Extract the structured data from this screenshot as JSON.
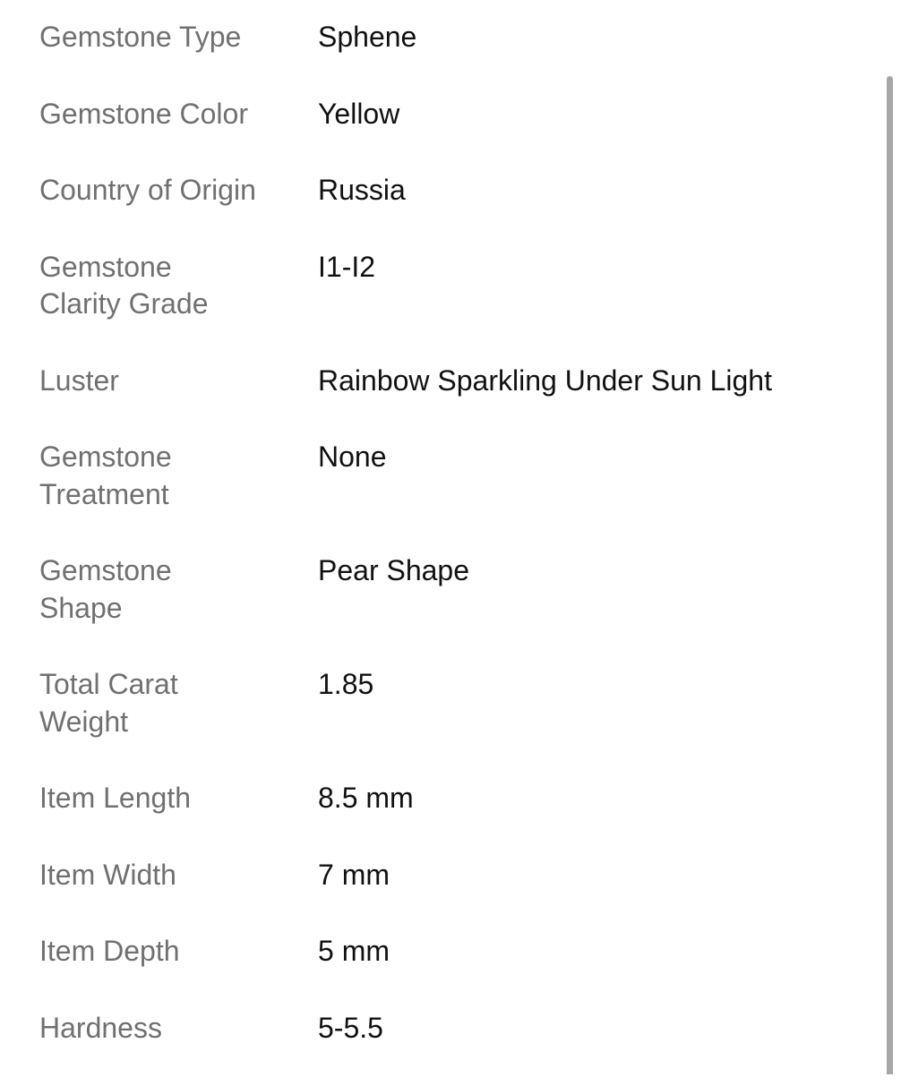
{
  "specifics": [
    {
      "label": "Gemstone Type",
      "value": "Sphene"
    },
    {
      "label": "Gemstone Color",
      "value": "Yellow"
    },
    {
      "label": "Country of Origin",
      "value": "Russia"
    },
    {
      "label": "Gemstone Clarity Grade",
      "value": "I1-I2"
    },
    {
      "label": "Luster",
      "value": "Rainbow Sparkling Under Sun Light"
    },
    {
      "label": "Gemstone Treatment",
      "value": "None"
    },
    {
      "label": "Gemstone Shape",
      "value": "Pear Shape"
    },
    {
      "label": "Total Carat Weight",
      "value": "1.85"
    },
    {
      "label": "Item Length",
      "value": "8.5 mm"
    },
    {
      "label": "Item Width",
      "value": "7 mm"
    },
    {
      "label": "Item Depth",
      "value": "5 mm"
    },
    {
      "label": "Hardness",
      "value": "5-5.5"
    }
  ]
}
